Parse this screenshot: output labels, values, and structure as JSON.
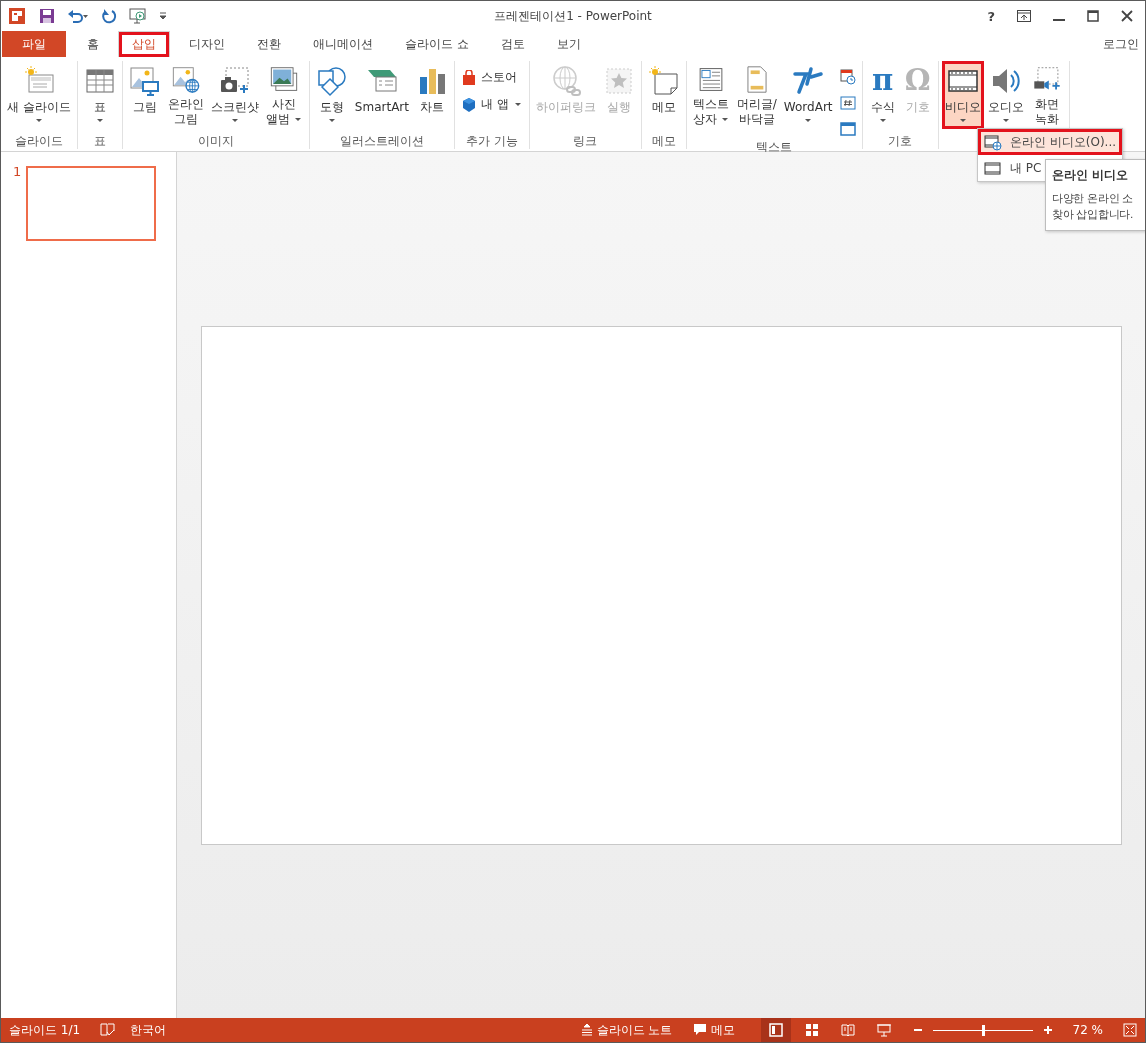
{
  "window": {
    "title": "프레젠테이션1 - PowerPoint",
    "help": "?"
  },
  "tabs": [
    {
      "label": "파일",
      "kind": "file",
      "selected": false,
      "highlighted": false
    },
    {
      "label": "홈",
      "kind": "tab",
      "selected": false,
      "highlighted": false
    },
    {
      "label": "삽입",
      "kind": "tab",
      "selected": true,
      "highlighted": true
    },
    {
      "label": "디자인",
      "kind": "tab",
      "selected": false,
      "highlighted": false
    },
    {
      "label": "전환",
      "kind": "tab",
      "selected": false,
      "highlighted": false
    },
    {
      "label": "애니메이션",
      "kind": "tab",
      "selected": false,
      "highlighted": false
    },
    {
      "label": "슬라이드 쇼",
      "kind": "tab",
      "selected": false,
      "highlighted": false
    },
    {
      "label": "검토",
      "kind": "tab",
      "selected": false,
      "highlighted": false
    },
    {
      "label": "보기",
      "kind": "tab",
      "selected": false,
      "highlighted": false
    }
  ],
  "account": "로그인",
  "ribbon": {
    "groups": [
      {
        "label": "슬라이드",
        "buttons": [
          {
            "kind": "large",
            "lines": [
              "새 슬라이드"
            ],
            "dropdown": true,
            "disabled": false,
            "pressed": false,
            "highlighted": false
          }
        ]
      },
      {
        "label": "표",
        "buttons": [
          {
            "kind": "large",
            "lines": [
              "표"
            ],
            "dropdown": true,
            "disabled": false,
            "pressed": false,
            "highlighted": false
          }
        ]
      },
      {
        "label": "이미지",
        "buttons": [
          {
            "kind": "large",
            "lines": [
              "그림"
            ],
            "dropdown": false,
            "disabled": false,
            "pressed": false,
            "highlighted": false
          },
          {
            "kind": "large",
            "lines": [
              "온라인",
              "그림"
            ],
            "dropdown": false,
            "disabled": false,
            "pressed": false,
            "highlighted": false
          },
          {
            "kind": "large",
            "lines": [
              "스크린샷"
            ],
            "dropdown": true,
            "disabled": false,
            "pressed": false,
            "highlighted": false
          },
          {
            "kind": "large",
            "lines": [
              "사진",
              "앨범"
            ],
            "dropdown": true,
            "disabled": false,
            "pressed": false,
            "highlighted": false
          }
        ]
      },
      {
        "label": "일러스트레이션",
        "buttons": [
          {
            "kind": "large",
            "lines": [
              "도형"
            ],
            "dropdown": true,
            "disabled": false,
            "pressed": false,
            "highlighted": false
          },
          {
            "kind": "large",
            "lines": [
              "SmartArt"
            ],
            "dropdown": false,
            "disabled": false,
            "pressed": false,
            "highlighted": false
          },
          {
            "kind": "large",
            "lines": [
              "차트"
            ],
            "dropdown": false,
            "disabled": false,
            "pressed": false,
            "highlighted": false
          }
        ]
      },
      {
        "label": "추가 기능",
        "buttons": [
          {
            "kind": "small",
            "lines": [
              "스토어"
            ],
            "dropdown": false,
            "disabled": false,
            "pressed": false,
            "highlighted": false
          },
          {
            "kind": "small",
            "lines": [
              "내 앱"
            ],
            "dropdown": true,
            "disabled": false,
            "pressed": false,
            "highlighted": false
          }
        ]
      },
      {
        "label": "링크",
        "buttons": [
          {
            "kind": "large",
            "lines": [
              "하이퍼링크"
            ],
            "dropdown": false,
            "disabled": true,
            "pressed": false,
            "highlighted": false
          },
          {
            "kind": "large",
            "lines": [
              "실행"
            ],
            "dropdown": false,
            "disabled": true,
            "pressed": false,
            "highlighted": false
          }
        ]
      },
      {
        "label": "메모",
        "buttons": [
          {
            "kind": "large",
            "lines": [
              "메모"
            ],
            "dropdown": false,
            "disabled": false,
            "pressed": false,
            "highlighted": false
          }
        ]
      },
      {
        "label": "텍스트",
        "buttons": [
          {
            "kind": "large",
            "lines": [
              "텍스트",
              "상자"
            ],
            "dropdown": true,
            "disabled": false,
            "pressed": false,
            "highlighted": false
          },
          {
            "kind": "large",
            "lines": [
              "머리글/",
              "바닥글"
            ],
            "dropdown": false,
            "disabled": false,
            "pressed": false,
            "highlighted": false
          },
          {
            "kind": "large",
            "lines": [
              "WordArt"
            ],
            "dropdown": true,
            "disabled": false,
            "pressed": false,
            "highlighted": false
          },
          {
            "kind": "small",
            "dropdown": false,
            "disabled": false,
            "pressed": false,
            "highlighted": false
          },
          {
            "kind": "small",
            "dropdown": false,
            "disabled": false,
            "pressed": false,
            "highlighted": false
          },
          {
            "kind": "small",
            "dropdown": false,
            "disabled": false,
            "pressed": false,
            "highlighted": false
          }
        ]
      },
      {
        "label": "기호",
        "buttons": [
          {
            "kind": "large",
            "glyph": "π",
            "lines": [
              "수식"
            ],
            "dropdown": true,
            "disabled": false,
            "pressed": false,
            "highlighted": false
          },
          {
            "kind": "large",
            "glyph": "Ω",
            "lines": [
              "기호"
            ],
            "dropdown": false,
            "disabled": true,
            "pressed": false,
            "highlighted": false
          }
        ]
      },
      {
        "buttons": [
          {
            "kind": "large",
            "lines": [
              "비디오"
            ],
            "dropdown": true,
            "disabled": false,
            "pressed": true,
            "highlighted": true
          },
          {
            "kind": "large",
            "lines": [
              "오디오"
            ],
            "dropdown": true,
            "disabled": false,
            "pressed": false,
            "highlighted": false
          },
          {
            "kind": "large",
            "lines": [
              "화면",
              "녹화"
            ],
            "dropdown": false,
            "disabled": false,
            "pressed": false,
            "highlighted": false
          }
        ]
      }
    ]
  },
  "video_menu": {
    "items": [
      {
        "label": "온라인 비디오(O)...",
        "selected": true,
        "highlighted": true
      },
      {
        "label": "내 PC",
        "selected": false,
        "highlighted": false
      }
    ]
  },
  "tooltip": {
    "title": "온라인 비디오",
    "lines": [
      "다양한 온라인 소",
      "찾아 삽입합니다."
    ]
  },
  "thumbnails": [
    {
      "number": "1",
      "selected": true
    }
  ],
  "status_bar": {
    "slide": "슬라이드 1/1",
    "language": "한국어",
    "notes": "슬라이드 노트",
    "comments": "메모",
    "views": [
      {
        "selected": true
      },
      {
        "selected": false
      },
      {
        "selected": false
      },
      {
        "selected": false
      }
    ],
    "zoom": {
      "level": 0.5,
      "reading": "72 %"
    }
  }
}
